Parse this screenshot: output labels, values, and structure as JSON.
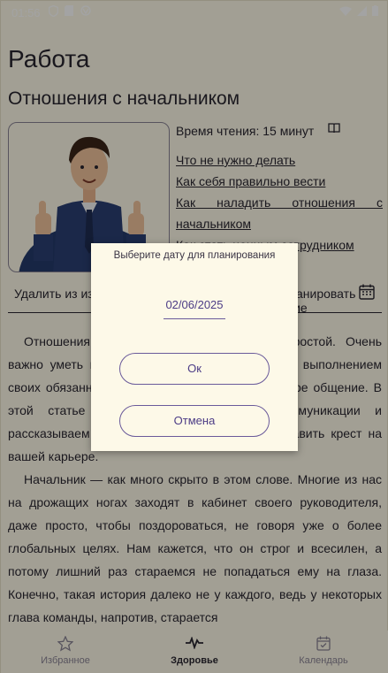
{
  "status": {
    "time": "01:56",
    "left_icons": [
      "shield-icon",
      "sim-icon",
      "vpn-icon"
    ],
    "right_icons": [
      "wifi-icon",
      "signal-icon",
      "battery-icon"
    ]
  },
  "page": {
    "title": "Работа",
    "subtitle": "Отношения с начальником",
    "reading_time": "Время чтения: 15 минут",
    "links": [
      "Что не нужно делать",
      "Как себя правильно вести",
      "Как наладить отношения с начальником",
      "Как стать ценным сотрудником"
    ],
    "delete_label": "Удалить из избранного",
    "plan_label": "Запланировать чтение",
    "article": [
      "Отношения с начальником — вопрос непростой. Очень важно уметь не только удивлять качественным выполнением своих обязанностей, но и при этом про грамотное общение. В этой статье мы раскрываем секреты коммуникации и рассказываем об ошибках, которые могут поставить крест на вашей карьере.",
      "Начальник — как много скрыто в этом слове. Многие из нас на дрожащих ногах заходят в кабинет своего руководителя, даже просто, чтобы поздороваться, не говоря уже о более глобальных целях. Нам кажется, что он строг и всесилен, а потому лишний раз стараемся не попадаться ему на глаза. Конечно, такая история далеко не у каждого, ведь у некоторых глава команды, напротив, старается"
    ]
  },
  "nav": {
    "items": [
      {
        "label": "Избранное",
        "icon": "star-icon",
        "active": false
      },
      {
        "label": "Здоровье",
        "icon": "pulse-icon",
        "active": true
      },
      {
        "label": "Календарь",
        "icon": "calendar-icon",
        "active": false
      }
    ]
  },
  "dialog": {
    "title": "Выберите дату для планирования",
    "date": "02/06/2025",
    "ok_label": "Ок",
    "cancel_label": "Отмена"
  },
  "colors": {
    "background": "#fdf9e8",
    "accent": "#6a5a9a",
    "text": "#2a2630",
    "scrim": "rgba(0,0,0,0.36)"
  }
}
